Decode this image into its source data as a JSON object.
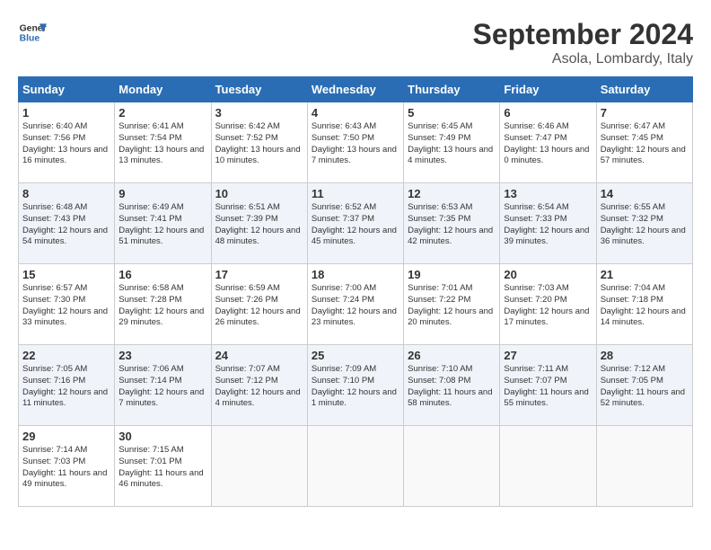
{
  "header": {
    "logo_line1": "General",
    "logo_line2": "Blue",
    "month": "September 2024",
    "location": "Asola, Lombardy, Italy"
  },
  "weekdays": [
    "Sunday",
    "Monday",
    "Tuesday",
    "Wednesday",
    "Thursday",
    "Friday",
    "Saturday"
  ],
  "weeks": [
    [
      {
        "day": "1",
        "sunrise": "Sunrise: 6:40 AM",
        "sunset": "Sunset: 7:56 PM",
        "daylight": "Daylight: 13 hours and 16 minutes."
      },
      {
        "day": "2",
        "sunrise": "Sunrise: 6:41 AM",
        "sunset": "Sunset: 7:54 PM",
        "daylight": "Daylight: 13 hours and 13 minutes."
      },
      {
        "day": "3",
        "sunrise": "Sunrise: 6:42 AM",
        "sunset": "Sunset: 7:52 PM",
        "daylight": "Daylight: 13 hours and 10 minutes."
      },
      {
        "day": "4",
        "sunrise": "Sunrise: 6:43 AM",
        "sunset": "Sunset: 7:50 PM",
        "daylight": "Daylight: 13 hours and 7 minutes."
      },
      {
        "day": "5",
        "sunrise": "Sunrise: 6:45 AM",
        "sunset": "Sunset: 7:49 PM",
        "daylight": "Daylight: 13 hours and 4 minutes."
      },
      {
        "day": "6",
        "sunrise": "Sunrise: 6:46 AM",
        "sunset": "Sunset: 7:47 PM",
        "daylight": "Daylight: 13 hours and 0 minutes."
      },
      {
        "day": "7",
        "sunrise": "Sunrise: 6:47 AM",
        "sunset": "Sunset: 7:45 PM",
        "daylight": "Daylight: 12 hours and 57 minutes."
      }
    ],
    [
      {
        "day": "8",
        "sunrise": "Sunrise: 6:48 AM",
        "sunset": "Sunset: 7:43 PM",
        "daylight": "Daylight: 12 hours and 54 minutes."
      },
      {
        "day": "9",
        "sunrise": "Sunrise: 6:49 AM",
        "sunset": "Sunset: 7:41 PM",
        "daylight": "Daylight: 12 hours and 51 minutes."
      },
      {
        "day": "10",
        "sunrise": "Sunrise: 6:51 AM",
        "sunset": "Sunset: 7:39 PM",
        "daylight": "Daylight: 12 hours and 48 minutes."
      },
      {
        "day": "11",
        "sunrise": "Sunrise: 6:52 AM",
        "sunset": "Sunset: 7:37 PM",
        "daylight": "Daylight: 12 hours and 45 minutes."
      },
      {
        "day": "12",
        "sunrise": "Sunrise: 6:53 AM",
        "sunset": "Sunset: 7:35 PM",
        "daylight": "Daylight: 12 hours and 42 minutes."
      },
      {
        "day": "13",
        "sunrise": "Sunrise: 6:54 AM",
        "sunset": "Sunset: 7:33 PM",
        "daylight": "Daylight: 12 hours and 39 minutes."
      },
      {
        "day": "14",
        "sunrise": "Sunrise: 6:55 AM",
        "sunset": "Sunset: 7:32 PM",
        "daylight": "Daylight: 12 hours and 36 minutes."
      }
    ],
    [
      {
        "day": "15",
        "sunrise": "Sunrise: 6:57 AM",
        "sunset": "Sunset: 7:30 PM",
        "daylight": "Daylight: 12 hours and 33 minutes."
      },
      {
        "day": "16",
        "sunrise": "Sunrise: 6:58 AM",
        "sunset": "Sunset: 7:28 PM",
        "daylight": "Daylight: 12 hours and 29 minutes."
      },
      {
        "day": "17",
        "sunrise": "Sunrise: 6:59 AM",
        "sunset": "Sunset: 7:26 PM",
        "daylight": "Daylight: 12 hours and 26 minutes."
      },
      {
        "day": "18",
        "sunrise": "Sunrise: 7:00 AM",
        "sunset": "Sunset: 7:24 PM",
        "daylight": "Daylight: 12 hours and 23 minutes."
      },
      {
        "day": "19",
        "sunrise": "Sunrise: 7:01 AM",
        "sunset": "Sunset: 7:22 PM",
        "daylight": "Daylight: 12 hours and 20 minutes."
      },
      {
        "day": "20",
        "sunrise": "Sunrise: 7:03 AM",
        "sunset": "Sunset: 7:20 PM",
        "daylight": "Daylight: 12 hours and 17 minutes."
      },
      {
        "day": "21",
        "sunrise": "Sunrise: 7:04 AM",
        "sunset": "Sunset: 7:18 PM",
        "daylight": "Daylight: 12 hours and 14 minutes."
      }
    ],
    [
      {
        "day": "22",
        "sunrise": "Sunrise: 7:05 AM",
        "sunset": "Sunset: 7:16 PM",
        "daylight": "Daylight: 12 hours and 11 minutes."
      },
      {
        "day": "23",
        "sunrise": "Sunrise: 7:06 AM",
        "sunset": "Sunset: 7:14 PM",
        "daylight": "Daylight: 12 hours and 7 minutes."
      },
      {
        "day": "24",
        "sunrise": "Sunrise: 7:07 AM",
        "sunset": "Sunset: 7:12 PM",
        "daylight": "Daylight: 12 hours and 4 minutes."
      },
      {
        "day": "25",
        "sunrise": "Sunrise: 7:09 AM",
        "sunset": "Sunset: 7:10 PM",
        "daylight": "Daylight: 12 hours and 1 minute."
      },
      {
        "day": "26",
        "sunrise": "Sunrise: 7:10 AM",
        "sunset": "Sunset: 7:08 PM",
        "daylight": "Daylight: 11 hours and 58 minutes."
      },
      {
        "day": "27",
        "sunrise": "Sunrise: 7:11 AM",
        "sunset": "Sunset: 7:07 PM",
        "daylight": "Daylight: 11 hours and 55 minutes."
      },
      {
        "day": "28",
        "sunrise": "Sunrise: 7:12 AM",
        "sunset": "Sunset: 7:05 PM",
        "daylight": "Daylight: 11 hours and 52 minutes."
      }
    ],
    [
      {
        "day": "29",
        "sunrise": "Sunrise: 7:14 AM",
        "sunset": "Sunset: 7:03 PM",
        "daylight": "Daylight: 11 hours and 49 minutes."
      },
      {
        "day": "30",
        "sunrise": "Sunrise: 7:15 AM",
        "sunset": "Sunset: 7:01 PM",
        "daylight": "Daylight: 11 hours and 46 minutes."
      },
      null,
      null,
      null,
      null,
      null
    ]
  ]
}
